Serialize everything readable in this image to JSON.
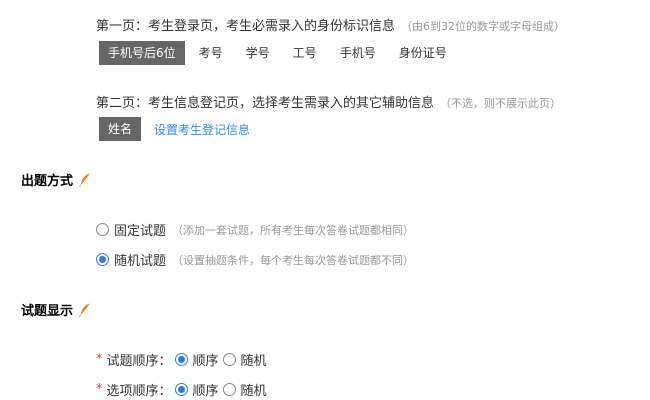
{
  "page1": {
    "heading": "第一页：考生登录页，考生必需录入的身份标识信息",
    "hint": "（由6到32位的数字或字母组成）",
    "tags": [
      "手机号后6位",
      "考号",
      "学号",
      "工号",
      "手机号",
      "身份证号"
    ],
    "active_tag": "手机号后6位"
  },
  "page2": {
    "heading": "第二页：考生信息登记页，选择考生需录入的其它辅助信息",
    "hint": "（不选，则不展示此页）",
    "tag": "姓名",
    "link": "设置考生登记信息"
  },
  "section_question_mode": {
    "title": "出题方式",
    "icon": "feather-pen-icon",
    "options": [
      {
        "label": "固定试题",
        "hint": "（添加一套试题，所有考生每次答卷试题都相同）",
        "checked": false
      },
      {
        "label": "随机试题",
        "hint": "（设置抽题条件，每个考生每次答卷试题都不同）",
        "checked": true
      }
    ]
  },
  "section_display": {
    "title": "试题显示",
    "icon": "feather-pen-icon",
    "rows": [
      {
        "required_mark": "*",
        "label": "试题顺序：",
        "choices": [
          "顺序",
          "随机"
        ],
        "selected": "顺序"
      },
      {
        "required_mark": "*",
        "label": "选项顺序：",
        "choices": [
          "顺序",
          "随机"
        ],
        "selected": "顺序"
      }
    ]
  },
  "colors": {
    "accent": "#2d7de0",
    "link": "#2d8cf0",
    "active_tag_bg": "#666666",
    "required": "#e53935",
    "feather": "#f07b22"
  }
}
